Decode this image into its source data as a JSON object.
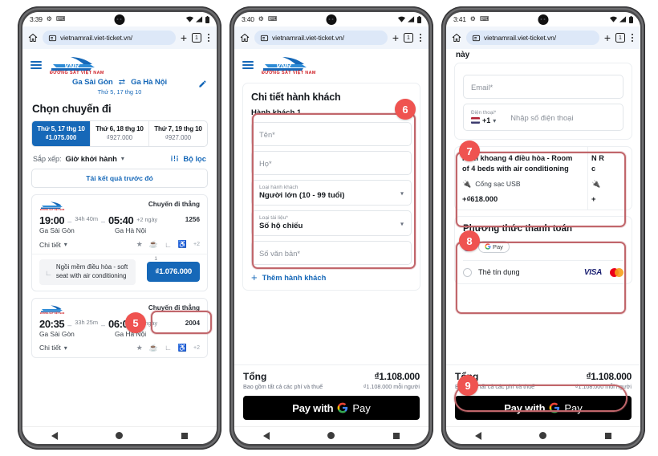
{
  "browser": {
    "url": "vietnamrail.viet-ticket.vn/",
    "tab_count": "1",
    "home_icon": "home-icon",
    "lock_icon": "page-info-icon",
    "new_tab_icon": "plus-icon",
    "menu_icon": "kebab-menu-icon"
  },
  "phones": [
    {
      "id": "phone-1",
      "status": {
        "time": "3:39",
        "icons": [
          "gear-icon",
          "shuffle-icon",
          "wifi-icon",
          "signal-icon",
          "battery-icon"
        ]
      },
      "header": {
        "menu_icon": "hamburger-icon",
        "logo_text": "VNR",
        "logo_sub": "ĐƯỜNG SẮT VIỆT NAM",
        "origin": "Ga Sài Gòn",
        "swap_icon": "swap-icon",
        "destination": "Ga Hà Nội",
        "date": "Thứ 5, 17 thg 10",
        "edit_icon": "pencil-icon"
      },
      "page_title": "Chọn chuyến đi",
      "date_options": [
        {
          "label": "Thứ 5, 17 thg 10",
          "price": "₫1.075.000",
          "selected": true
        },
        {
          "label": "Thứ 6, 18 thg 10",
          "price": "₫927.000",
          "selected": false
        },
        {
          "label": "Thứ 7, 19 thg 10",
          "price": "₫927.000",
          "selected": false
        }
      ],
      "sort": {
        "label": "Sắp xếp:",
        "value": "Giờ khởi hành",
        "chevron": "chevron-down-icon"
      },
      "filter": {
        "icon": "filter-icon",
        "label": "Bộ lọc"
      },
      "load_previous": "Tải kết quả trước đó",
      "trips": [
        {
          "direct_label": "Chuyến đi thẳng",
          "depart_time": "19:00",
          "duration": "34h 40m",
          "arrive_time": "05:40",
          "plus_days": "+2 ngày",
          "train_no": "1256",
          "from": "Ga Sài Gòn",
          "to": "Ga Hà Nội",
          "details_label": "Chi tiết",
          "amenity_more": "+2",
          "seat_name": "Ngồi mềm điều hòa - soft seat with air conditioning",
          "seat_count": "1",
          "price": "₫1.076.000"
        },
        {
          "direct_label": "Chuyến đi thẳng",
          "depart_time": "20:35",
          "duration": "33h 25m",
          "arrive_time": "06:00",
          "plus_days": "+2 ngày",
          "train_no": "2004",
          "from": "Ga Sài Gòn",
          "to": "Ga Hà Nội",
          "details_label": "Chi tiết",
          "amenity_more": "+2"
        }
      ],
      "annotations": [
        {
          "number": "5",
          "target": "price-button"
        }
      ]
    },
    {
      "id": "phone-2",
      "status": {
        "time": "3:40"
      },
      "card_title": "Chi tiết hành khách",
      "passenger_label": "Hành khách 1",
      "fields": [
        {
          "name": "first-name-field",
          "placeholder": "Tên*",
          "type": "text"
        },
        {
          "name": "last-name-field",
          "placeholder": "Họ*",
          "type": "text"
        },
        {
          "name": "passenger-type-select",
          "label": "Loại hành khách",
          "value": "Người lớn (10 - 99 tuổi)",
          "type": "select"
        },
        {
          "name": "document-type-select",
          "label": "Loại tài liệu*",
          "value": "Số hộ chiếu",
          "type": "select"
        },
        {
          "name": "document-number-field",
          "placeholder": "Số văn bản*",
          "type": "text"
        }
      ],
      "add_passenger": "Thêm hành khách",
      "total": {
        "label": "Tổng",
        "amount": "₫1.108.000",
        "subtitle": "Bao gồm tất cả các phí và thuế",
        "per_person": "₫1.108.000 mỗi người"
      },
      "pay_button": {
        "prefix": "Pay with",
        "brand_g": "G",
        "brand_pay": "Pay"
      },
      "annotations": [
        {
          "number": "6",
          "target": "passenger-form"
        }
      ]
    },
    {
      "id": "phone-3",
      "status": {
        "time": "3:41"
      },
      "top_text": "này",
      "email_placeholder": "Email*",
      "phone": {
        "label": "Điện thoại*",
        "country_code": "+1",
        "chevron": "chevron-down-icon",
        "placeholder": "Nhập số điện thoại"
      },
      "options": [
        {
          "name": "Nằm khoang 4 điều hòa - Room of 4 beds with air conditioning",
          "feature_icon": "usb-icon",
          "feature": "Cổng sạc USB",
          "price": "+₫618.000"
        },
        {
          "name": "N R c",
          "feature": "",
          "price": "+"
        }
      ],
      "payment": {
        "title": "Phương thức thanh toán",
        "methods": [
          {
            "name": "gpay-option",
            "label_g": "G",
            "label_pay": "Pay",
            "selected": true
          },
          {
            "name": "credit-card-option",
            "label": "Thẻ tín dụng",
            "selected": false,
            "brands": [
              "VISA",
              "mastercard"
            ]
          }
        ]
      },
      "total": {
        "label": "Tổng",
        "amount": "₫1.108.000",
        "subtitle": "Bao gồm tất cả các phí và thuế",
        "per_person": "₫1.108.000 mỗi người"
      },
      "pay_button": {
        "prefix": "Pay with",
        "brand_g": "G",
        "brand_pay": "Pay"
      },
      "annotations": [
        {
          "number": "7",
          "target": "option-card"
        },
        {
          "number": "8",
          "target": "payment-card"
        },
        {
          "number": "9",
          "target": "pay-button"
        }
      ]
    }
  ],
  "colors": {
    "brand_blue": "#1668b8",
    "badge_red": "#ef5350",
    "highlight": "#c1666b"
  }
}
